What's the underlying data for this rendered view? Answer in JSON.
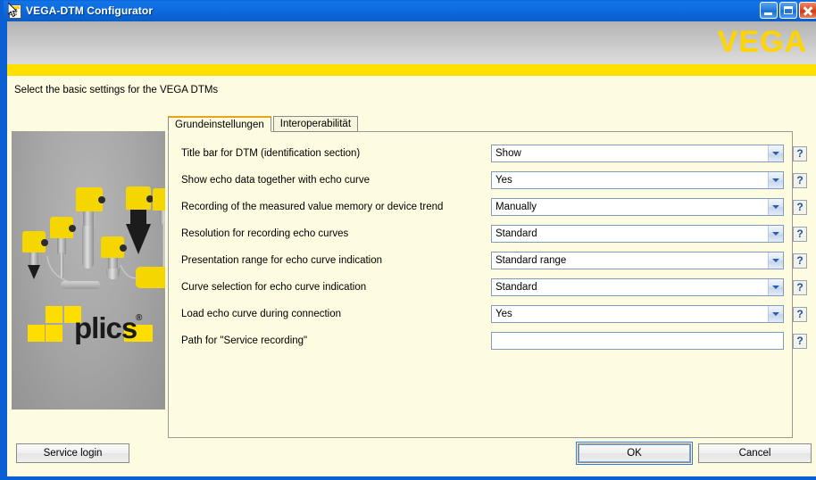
{
  "window": {
    "title": "VEGA-DTM Configurator",
    "icon": "document-icon",
    "caption_buttons": [
      {
        "name": "minimize",
        "glyph": "minimize-icon"
      },
      {
        "name": "maximize",
        "glyph": "maximize-icon"
      },
      {
        "name": "close",
        "glyph": "close-icon"
      }
    ]
  },
  "header": {
    "brand": "VEGA",
    "brand_color": "#ffd400",
    "band_color": "#ffe000"
  },
  "instruction": "Select the basic settings for the VEGA DTMs",
  "image_panel": {
    "logo_text": "plics",
    "logo_registered": "®",
    "alt": "VEGA plics sensor family"
  },
  "tabs": [
    {
      "label": "Grundeinstellungen",
      "active": true
    },
    {
      "label": "Interoperabilität",
      "active": false
    }
  ],
  "rows": [
    {
      "label": "Title bar for DTM (identification section)",
      "value": "Show",
      "type": "select",
      "help": "?"
    },
    {
      "label": "Show echo data together with echo curve",
      "value": "Yes",
      "type": "select",
      "help": "?"
    },
    {
      "label": "Recording of the measured value memory or device trend",
      "value": "Manually",
      "type": "select",
      "help": "?"
    },
    {
      "label": "Resolution for recording echo curves",
      "value": "Standard",
      "type": "select",
      "help": "?"
    },
    {
      "label": "Presentation range for echo curve indication",
      "value": "Standard range",
      "type": "select",
      "help": "?"
    },
    {
      "label": "Curve selection for echo curve indication",
      "value": "Standard",
      "type": "select",
      "help": "?"
    },
    {
      "label": "Load echo curve during connection",
      "value": "Yes",
      "type": "select",
      "help": "?"
    },
    {
      "label": "Path for \"Service recording\"",
      "value": "",
      "type": "text",
      "help": "?"
    }
  ],
  "buttons": {
    "service_login": "Service login",
    "ok": "OK",
    "cancel": "Cancel"
  }
}
